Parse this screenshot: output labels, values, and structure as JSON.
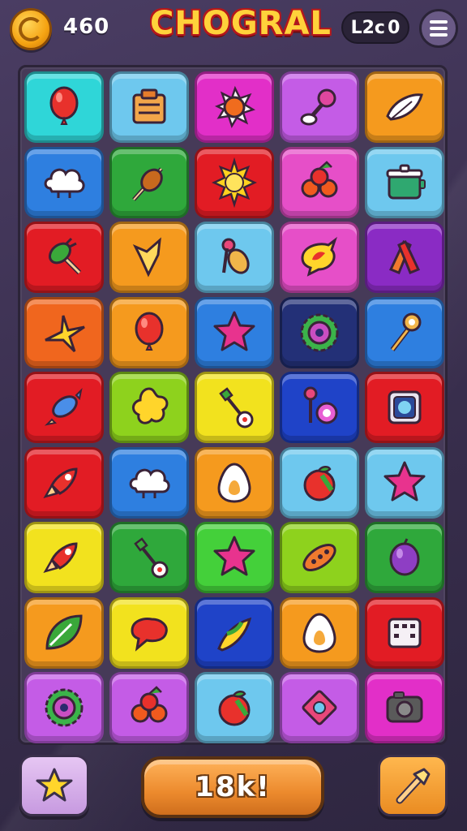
{
  "header": {
    "score": "460",
    "title": "CHOGRAL",
    "level_label": "L2c",
    "level_value": "0"
  },
  "action_button": {
    "label": "18k!"
  },
  "colors": {
    "cyan": "#2fd6d8",
    "skyblue": "#6ec8ee",
    "magenta": "#e22fc8",
    "violet": "#c45ce6",
    "orange": "#f59a1e",
    "blue": "#2e7fe0",
    "green": "#2fa83b",
    "red": "#e21c24",
    "pink": "#e64fc8",
    "purple": "#8a2bc4",
    "navy": "#233077",
    "yellow": "#f2e21e",
    "lime": "#8ed21d",
    "brightgreen": "#44d03a",
    "deepblue": "#1f43c8",
    "orangered": "#f0661e"
  },
  "tiles": [
    {
      "bg": "cyan",
      "icon": "balloon-icon"
    },
    {
      "bg": "skyblue",
      "icon": "crate-icon"
    },
    {
      "bg": "magenta",
      "icon": "orange-burst-icon"
    },
    {
      "bg": "violet",
      "icon": "candy-icon"
    },
    {
      "bg": "orange",
      "icon": "feather-icon"
    },
    {
      "bg": "blue",
      "icon": "cloud-icon"
    },
    {
      "bg": "green",
      "icon": "skewer-icon"
    },
    {
      "bg": "red",
      "icon": "sun-icon"
    },
    {
      "bg": "pink",
      "icon": "cherries-icon"
    },
    {
      "bg": "skyblue",
      "icon": "pot-icon"
    },
    {
      "bg": "red",
      "icon": "carrot-icon"
    },
    {
      "bg": "orange",
      "icon": "shard-icon"
    },
    {
      "bg": "skyblue",
      "icon": "popsicle-icon"
    },
    {
      "bg": "pink",
      "icon": "flame-bubble-icon"
    },
    {
      "bg": "purple",
      "icon": "ribbon-icon"
    },
    {
      "bg": "orangered",
      "icon": "sparkle-icon"
    },
    {
      "bg": "orange",
      "icon": "balloon-icon"
    },
    {
      "bg": "blue",
      "icon": "star-icon"
    },
    {
      "bg": "navy",
      "icon": "gear-icon"
    },
    {
      "bg": "blue",
      "icon": "wand-icon"
    },
    {
      "bg": "red",
      "icon": "candy-wrap-icon"
    },
    {
      "bg": "lime",
      "icon": "star-blob-icon"
    },
    {
      "bg": "yellow",
      "icon": "flower-stick-icon"
    },
    {
      "bg": "deepblue",
      "icon": "lollipop-icon"
    },
    {
      "bg": "red",
      "icon": "frame-icon"
    },
    {
      "bg": "red",
      "icon": "rocket-icon"
    },
    {
      "bg": "blue",
      "icon": "cloud-icon"
    },
    {
      "bg": "orange",
      "icon": "egg-icon"
    },
    {
      "bg": "skyblue",
      "icon": "apple-icon"
    },
    {
      "bg": "skyblue",
      "icon": "star-icon"
    },
    {
      "bg": "yellow",
      "icon": "rocket-icon"
    },
    {
      "bg": "green",
      "icon": "flower-stick-icon"
    },
    {
      "bg": "brightgreen",
      "icon": "star-icon"
    },
    {
      "bg": "lime",
      "icon": "pickle-icon"
    },
    {
      "bg": "green",
      "icon": "plum-icon"
    },
    {
      "bg": "orange",
      "icon": "leaf-icon"
    },
    {
      "bg": "yellow",
      "icon": "speech-bubble-icon"
    },
    {
      "bg": "deepblue",
      "icon": "banana-icon"
    },
    {
      "bg": "orange",
      "icon": "egg-icon"
    },
    {
      "bg": "red",
      "icon": "calculator-icon"
    },
    {
      "bg": "violet",
      "icon": "gear-icon"
    },
    {
      "bg": "violet",
      "icon": "cherries-icon"
    },
    {
      "bg": "skyblue",
      "icon": "apple-icon"
    },
    {
      "bg": "violet",
      "icon": "diamond-icon"
    },
    {
      "bg": "magenta",
      "icon": "camera-icon"
    }
  ]
}
